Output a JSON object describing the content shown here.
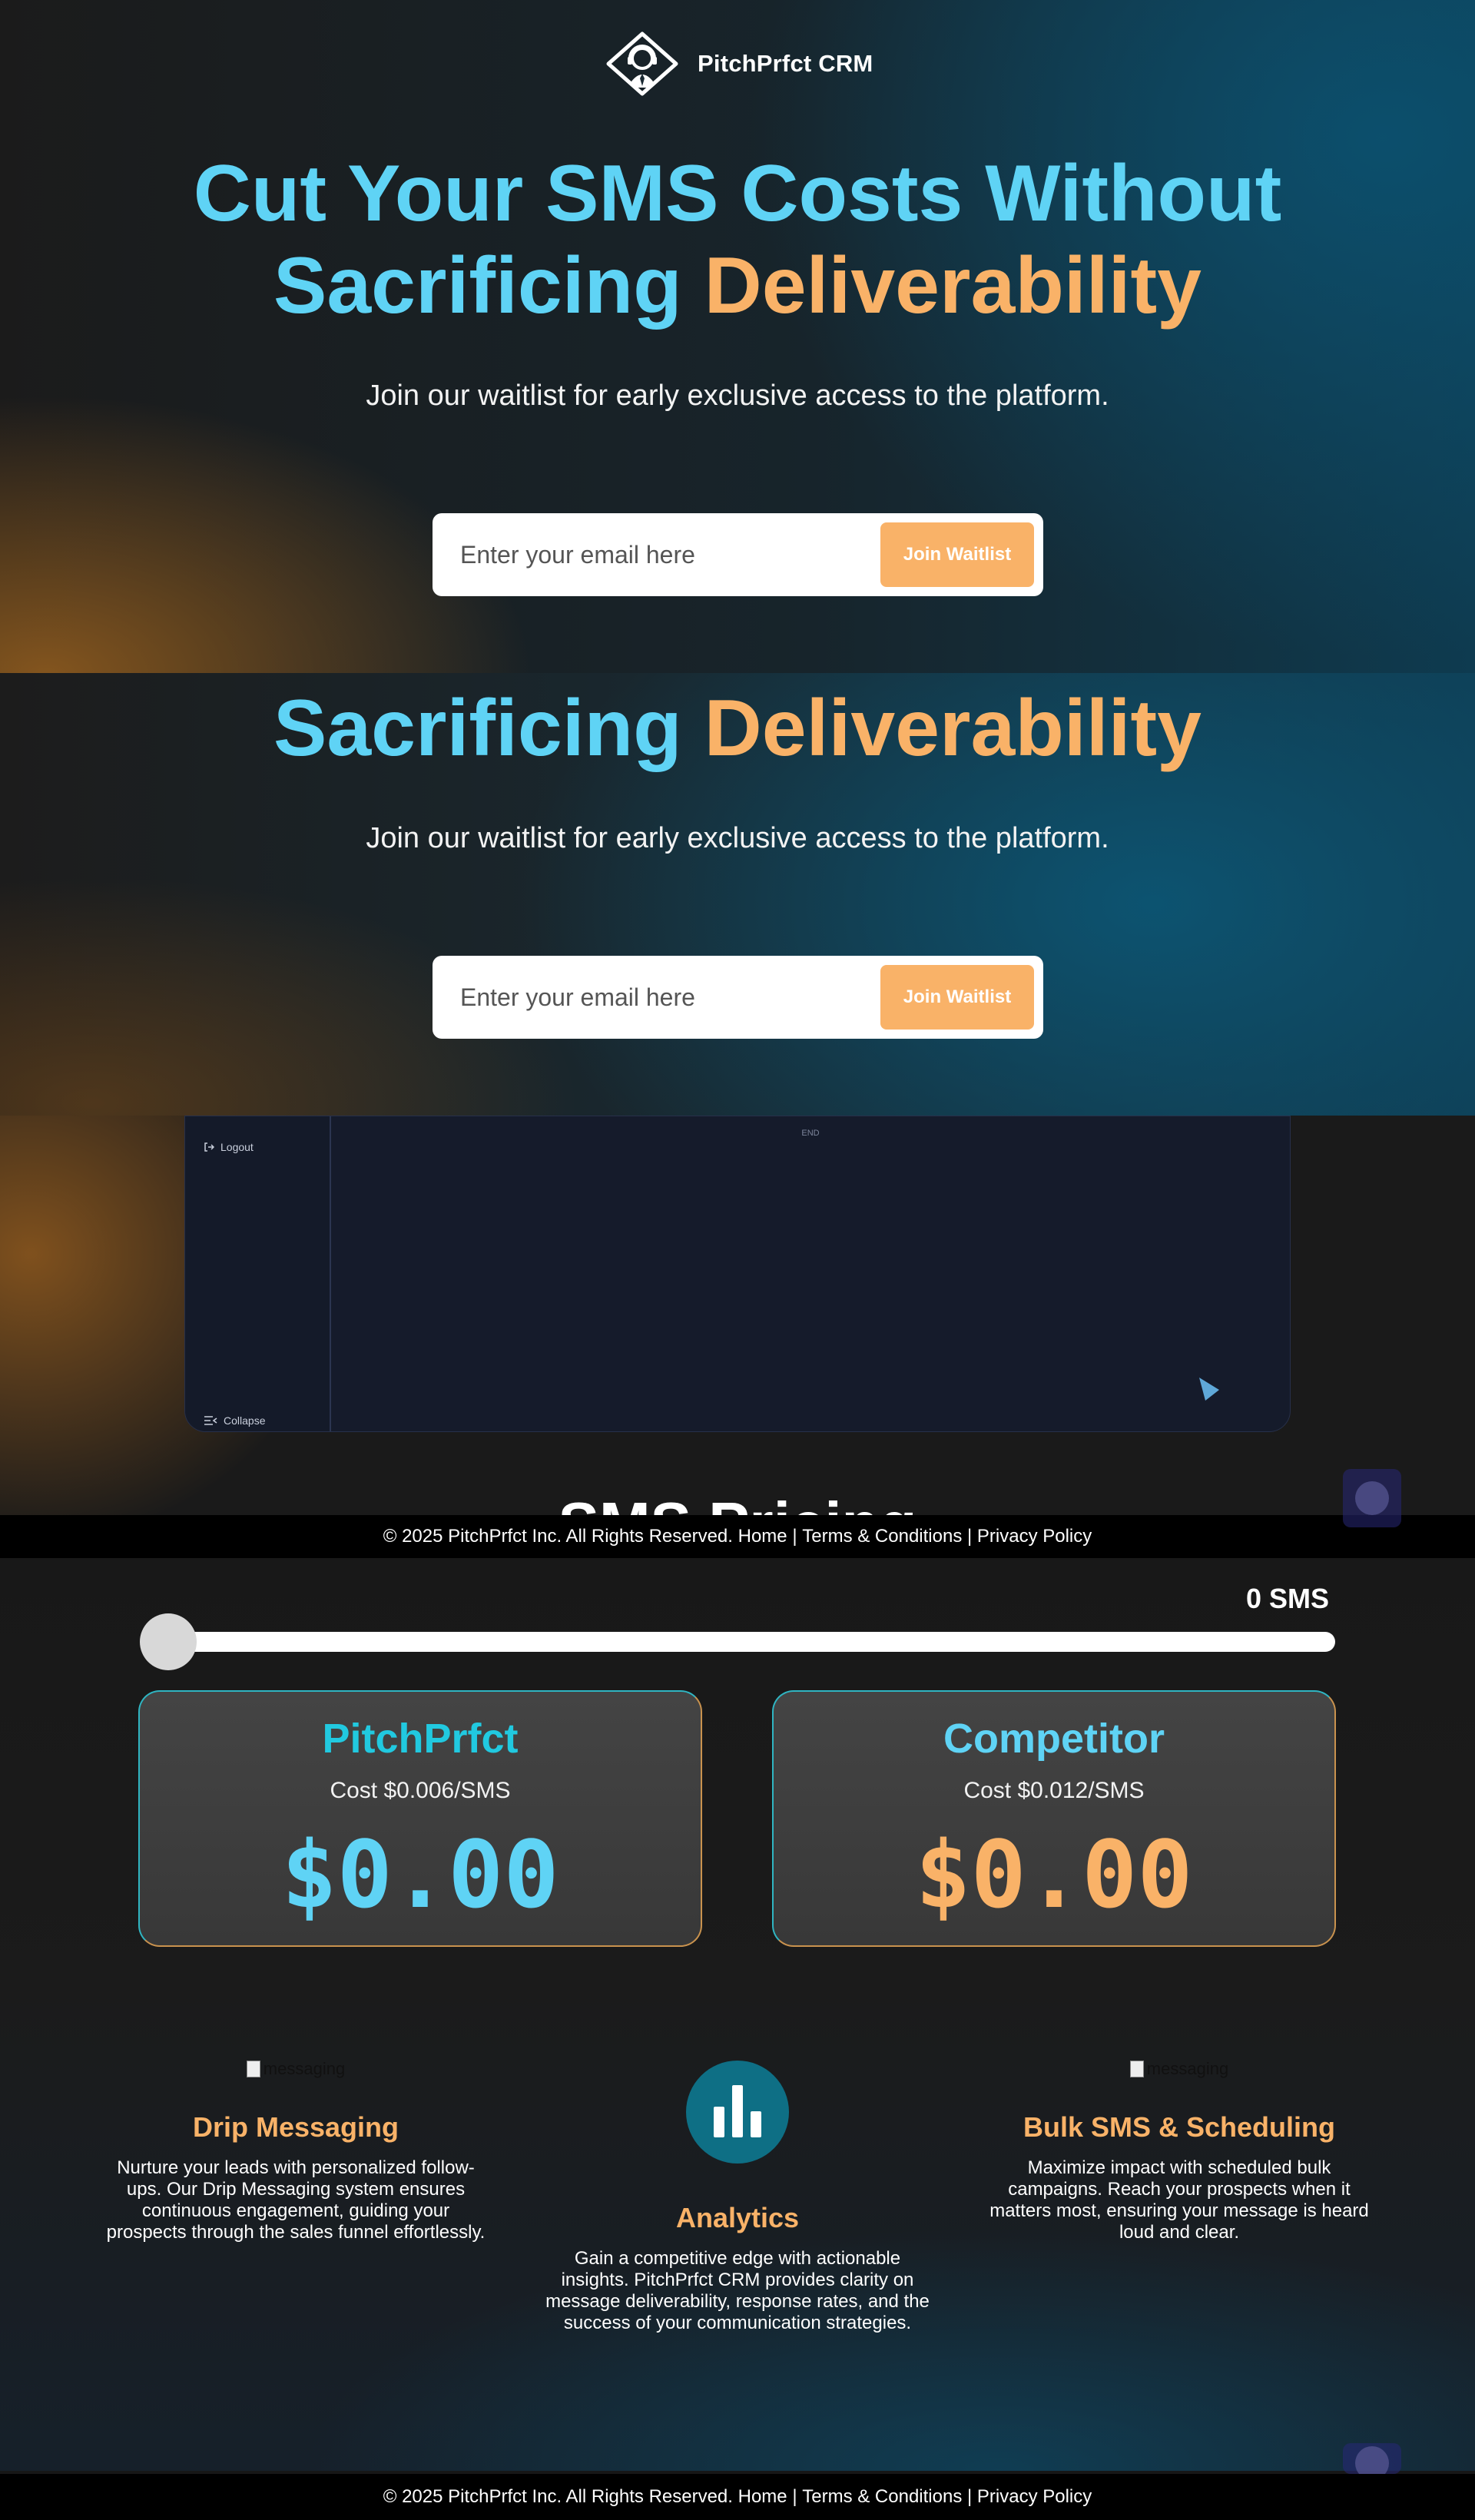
{
  "brand": {
    "name": "PitchPrfct CRM"
  },
  "hero": {
    "headline_line1": "Cut Your SMS Costs Without",
    "headline_line2_a": "Sacrificing",
    "headline_line2_b": "Deliverability",
    "subline": "Join our waitlist for early exclusive access to the platform.",
    "email_placeholder": "Enter your email here",
    "join_label": "Join Waitlist"
  },
  "dashboard": {
    "logout_label": "Logout",
    "collapse_label": "Collapse",
    "end_label": "END"
  },
  "footer": {
    "copyright": "© 2025 PitchPrfct Inc. All Rights Reserved.",
    "home": "Home",
    "separator": "|",
    "terms": "Terms & Conditions",
    "privacy": "Privacy Policy"
  },
  "pricing": {
    "title_partial": "SMS Pricing",
    "sms_count": "0 SMS",
    "slider_value": 0,
    "cards": [
      {
        "name": "PitchPrfct",
        "cost": "Cost $0.006/SMS",
        "total": "$0.00",
        "name_color": "#21c9e0",
        "total_color": "#5fd3f5"
      },
      {
        "name": "Competitor",
        "cost": "Cost $0.012/SMS",
        "total": "$0.00",
        "name_color": "#5fd3f5",
        "total_color": "#f9b268"
      }
    ]
  },
  "features": [
    {
      "img_alt": "messaging",
      "title": "Drip Messaging",
      "desc": "Nurture your leads with personalized follow-ups. Our Drip Messaging system ensures continuous engagement, guiding your prospects through the sales funnel effortlessly."
    },
    {
      "title": "Analytics",
      "desc": "Gain a competitive edge with actionable insights. PitchPrfct CRM provides clarity on message deliverability, response rates, and the success of your communication strategies."
    },
    {
      "img_alt": "messaging",
      "title": "Bulk SMS & Scheduling",
      "desc": "Maximize impact with scheduled bulk campaigns. Reach your prospects when it matters most, ensuring your message is heard loud and clear."
    }
  ],
  "colors": {
    "accent_blue": "#5fd3f5",
    "accent_orange": "#f9b268"
  }
}
